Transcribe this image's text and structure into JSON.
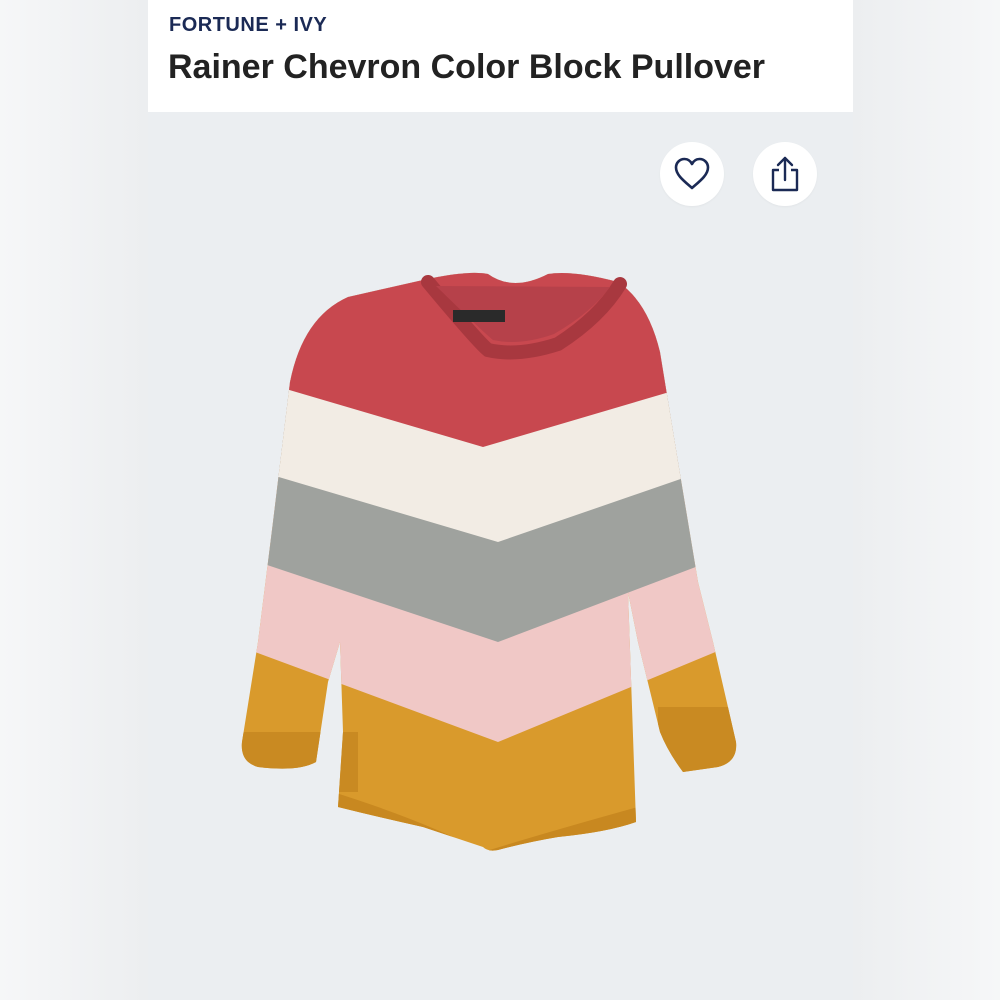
{
  "header": {
    "brand": "FORTUNE + IVY",
    "title": "Rainer Chevron Color Block Pullover"
  },
  "actions": {
    "favorite_icon": "heart-outline-icon",
    "share_icon": "share-upload-icon"
  },
  "product_image": {
    "subject": "sweater",
    "stripe_colors": [
      "#c8484f",
      "#f2ece4",
      "#9fa29e",
      "#f0c8c6",
      "#d99a2c"
    ],
    "icon_color": "#1b2a55"
  }
}
